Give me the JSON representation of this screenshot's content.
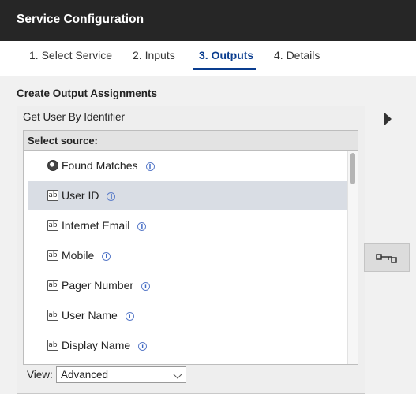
{
  "window": {
    "title": "Service Configuration"
  },
  "tabs": [
    {
      "label": "1. Select Service",
      "active": false
    },
    {
      "label": "2. Inputs",
      "active": false
    },
    {
      "label": "3. Outputs",
      "active": true
    },
    {
      "label": "4. Details",
      "active": false
    }
  ],
  "section": {
    "heading": "Create Output Assignments"
  },
  "panel": {
    "title": "Get User By Identifier",
    "source_header": "Select source:",
    "items": [
      {
        "label": "Found Matches",
        "icon": "boolean-icon",
        "selected": false
      },
      {
        "label": "User ID",
        "icon": "text-field-icon",
        "selected": true
      },
      {
        "label": "Internet Email",
        "icon": "text-field-icon",
        "selected": false
      },
      {
        "label": "Mobile",
        "icon": "text-field-icon",
        "selected": false
      },
      {
        "label": "Pager Number",
        "icon": "text-field-icon",
        "selected": false
      },
      {
        "label": "User Name",
        "icon": "text-field-icon",
        "selected": false
      },
      {
        "label": "Display Name",
        "icon": "text-field-icon",
        "selected": false
      }
    ],
    "text_icon_glyph": "ab",
    "info_glyph": "i"
  },
  "view": {
    "label": "View:",
    "selected": "Advanced"
  },
  "colors": {
    "titlebar": "#262626",
    "accent": "#0a3d8f",
    "selected_row": "#d9dde4",
    "info": "#3a66c4"
  }
}
